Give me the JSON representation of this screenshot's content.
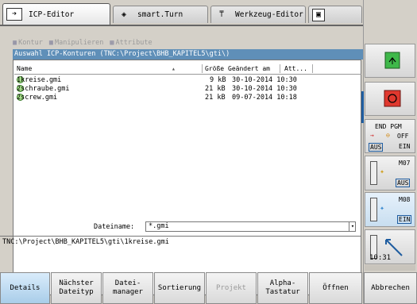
{
  "tabs": [
    {
      "label": "ICP-Editor",
      "icon": "arrow-right-icon"
    },
    {
      "label": "smart.Turn",
      "icon": "diamond-arrow-icon"
    },
    {
      "label": "Werkzeug-Editor",
      "icon": "tool-icon"
    },
    {
      "label": "",
      "icon": "floppy-icon"
    }
  ],
  "menu": {
    "kontur": "Kontur",
    "manipulieren": "Manipulieren",
    "attribute": "Attribute"
  },
  "dialog_title": "Auswahl ICP-Konturen  (TNC:\\Project\\BHB_KAPITEL5\\gti\\)",
  "columns": {
    "name": "Name",
    "size": "Größe",
    "date": "Geändert am",
    "attr": "Att..."
  },
  "files": [
    {
      "name": "1kreise.gmi",
      "size": "9 kB",
      "date": "30-10-2014 10:30",
      "selected": false
    },
    {
      "name": "2schraube.gmi",
      "size": "21 kB",
      "date": "30-10-2014 10:30",
      "selected": true
    },
    {
      "name": "2screw.gmi",
      "size": "21 kB",
      "date": "09-07-2014 10:18",
      "selected": false
    }
  ],
  "filename_label": "Dateiname:",
  "filename_value": "*.gmi",
  "path": "TNC:\\Project\\BHB_KAPITEL5\\gti\\1kreise.gmi",
  "clock": "10:31",
  "side": {
    "endpgm": {
      "title": "END PGM",
      "state": "OFF",
      "aus": "AUS",
      "ein": "EIN"
    },
    "m07": {
      "title": "M07",
      "aus": "AUS"
    },
    "m08": {
      "title": "M08",
      "ein": "EIN"
    }
  },
  "softkeys": [
    {
      "label": "Details",
      "active": true,
      "disabled": false
    },
    {
      "label": "Nächster\nDateityp",
      "active": false,
      "disabled": false
    },
    {
      "label": "Datei-\nmanager",
      "active": false,
      "disabled": false
    },
    {
      "label": "Sortierung",
      "active": false,
      "disabled": false
    },
    {
      "label": "Projekt",
      "active": false,
      "disabled": true
    },
    {
      "label": "Alpha-\nTastatur",
      "active": false,
      "disabled": false
    },
    {
      "label": "Öffnen",
      "active": false,
      "disabled": false
    },
    {
      "label": "Abbrechen",
      "active": false,
      "disabled": false
    }
  ]
}
